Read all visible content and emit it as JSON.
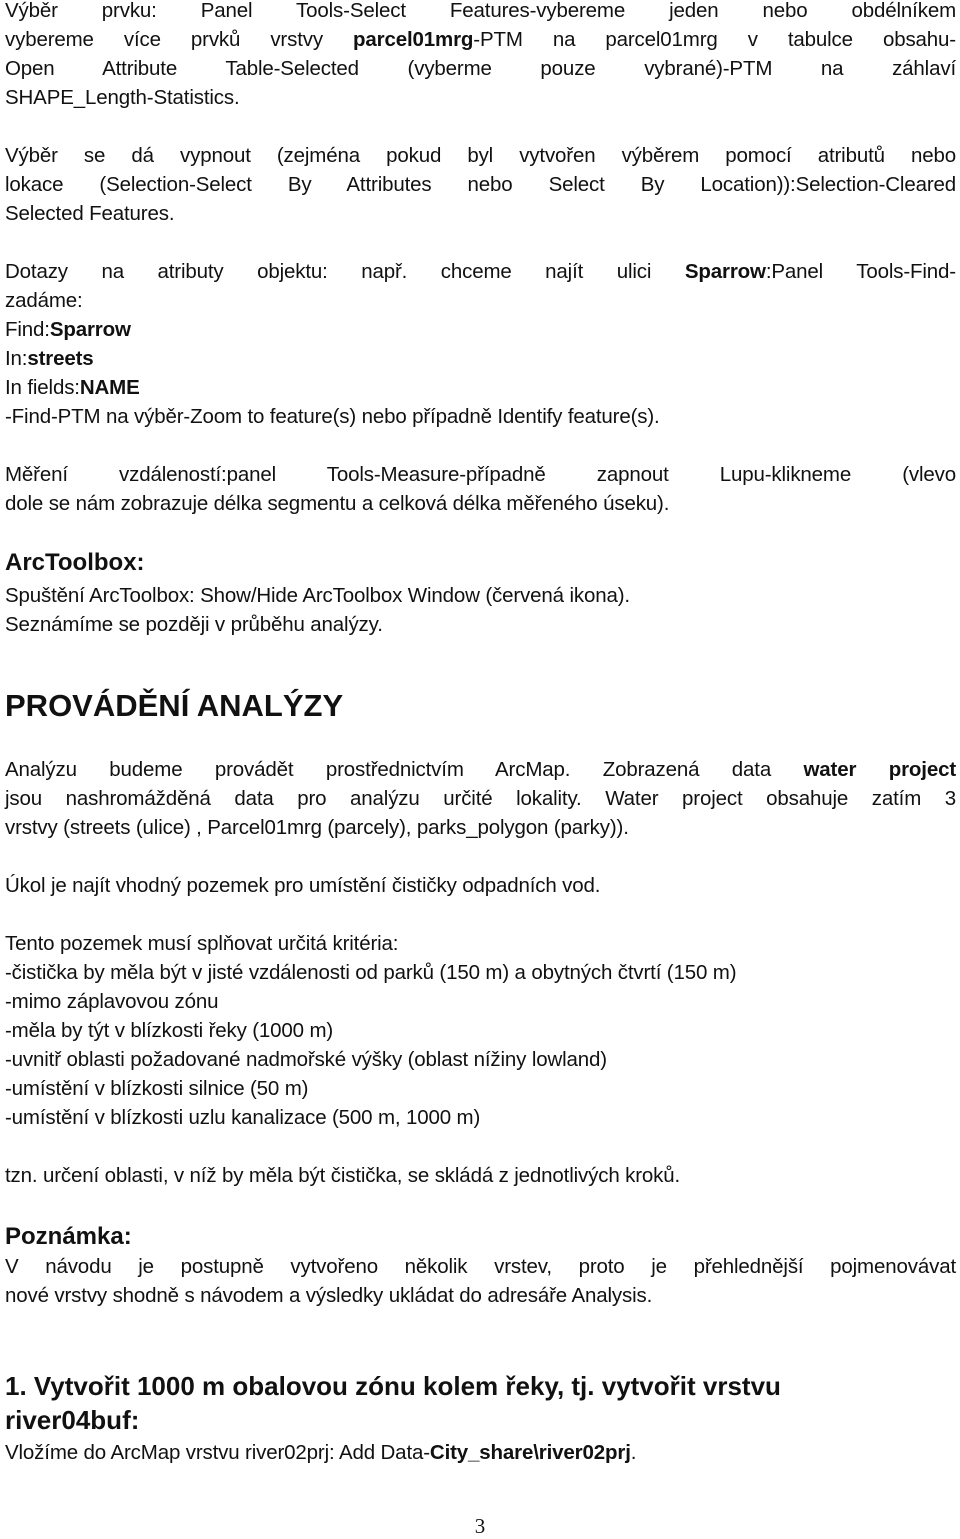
{
  "page": {
    "number": "3"
  },
  "p1": {
    "l1": "Výběr prvku: Panel Tools-Select Features-vybereme jeden nebo obdélníkem",
    "l2a": "vybereme více prvků vrstvy ",
    "l2b": "parcel01mrg",
    "l2c": "-PTM na parcel01mrg v tabulce obsahu-",
    "l3": "Open Attribute Table-Selected (vyberme pouze vybrané)-PTM na záhlaví",
    "l4": "SHAPE_Length-Statistics."
  },
  "p2": {
    "l1": "Výběr se dá vypnout (zejména pokud byl vytvořen výběrem pomocí atributů nebo",
    "l2": "lokace (Selection-Select By Attributes nebo Select By Location)):Selection-Cleared",
    "l3": "Selected Features."
  },
  "p3": {
    "l1a": "Dotazy na atributy objektu: např. chceme najít ulici ",
    "l1b": "Sparrow",
    "l1c": ":Panel Tools-Find-",
    "l2": "zadáme:",
    "find_label": "Find:",
    "find_value": "Sparrow",
    "in_label": "In:",
    "in_value": "streets",
    "fields_label": "In fields:",
    "fields_value": "NAME",
    "l6": "-Find-PTM na výběr-Zoom to feature(s) nebo případně Identify feature(s)."
  },
  "p4": {
    "l1": "Měření vzdáleností:panel Tools-Measure-případně zapnout Lupu-klikneme (vlevo",
    "l2": "dole se nám zobrazuje délka segmentu a celková délka měřeného úseku)."
  },
  "arctoolbox": {
    "heading": "ArcToolbox:",
    "l1": "Spuštění ArcToolbox: Show/Hide ArcToolbox Window (červená ikona).",
    "l2": "Seznámíme se později v průběhu analýzy."
  },
  "analysis": {
    "heading": "PROVÁDĚNÍ ANALÝZY",
    "l1a": "Analýzu budeme provádět prostřednictvím ArcMap. Zobrazená data ",
    "l1b": "water project",
    "l2": "jsou nashromážděná data pro analýzu určité lokality. Water project obsahuje zatím 3",
    "l3": "vrstvy (streets (ulice) , Parcel01mrg (parcely),  parks_polygon (parky)).",
    "task": "Úkol je najít vhodný pozemek pro umístění čističky odpadních vod.",
    "criteria_intro": "Tento pozemek musí splňovat určitá kritéria:",
    "criteria": [
      "-čistička by měla být v jisté vzdálenosti od parků (150 m) a obytných čtvrtí (150 m)",
      "-mimo záplavovou zónu",
      "-měla by týt v blízkosti řeky (1000 m)",
      "-uvnitř oblasti požadované nadmořské výšky (oblast nížiny lowland)",
      "-umístění v blízkosti silnice (50 m)",
      "-umístění v blízkosti uzlu kanalizace (500 m, 1000 m)"
    ],
    "summary": "tzn. určení oblasti, v níž by měla být čistička, se skládá z jednotlivých kroků."
  },
  "note": {
    "heading": "Poznámka:",
    "l1": "V návodu je postupně vytvořeno několik vrstev, proto je přehlednější pojmenovávat",
    "l2": "nové vrstvy shodně s návodem a výsledky ukládat do adresáře Analysis."
  },
  "step1": {
    "heading_l1": "1. Vytvořit 1000 m obalovou zónu kolem řeky, tj. vytvořit vrstvu",
    "heading_l2": "river04buf:",
    "l1a": "Vložíme do ArcMap vrstvu river02prj: Add Data-",
    "l1b": "City_share\\river02prj",
    "l1c": "."
  }
}
